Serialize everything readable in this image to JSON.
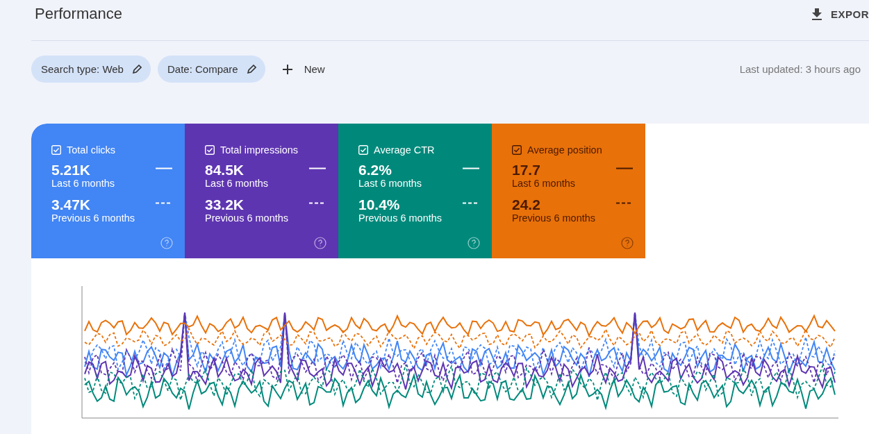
{
  "header": {
    "title": "Performance",
    "export_label": "EXPOR"
  },
  "filters": [
    {
      "label": "Search type: Web"
    },
    {
      "label": "Date: Compare"
    }
  ],
  "new_filter": {
    "label": "New"
  },
  "last_updated": "Last updated: 3 hours ago",
  "metrics": [
    {
      "label": "Total clicks",
      "checked": true,
      "color": "#4285f4",
      "current": "5.21K",
      "current_label": "Last 6 months",
      "previous": "3.47K",
      "previous_label": "Previous 6 months"
    },
    {
      "label": "Total impressions",
      "checked": true,
      "color": "#5e35b1",
      "current": "84.5K",
      "current_label": "Last 6 months",
      "previous": "33.2K",
      "previous_label": "Previous 6 months"
    },
    {
      "label": "Average CTR",
      "checked": true,
      "color": "#00897b",
      "current": "6.2%",
      "current_label": "Last 6 months",
      "previous": "10.4%",
      "previous_label": "Previous 6 months"
    },
    {
      "label": "Average position",
      "checked": true,
      "color": "#e8710a",
      "current": "17.7",
      "current_label": "Last 6 months",
      "previous": "24.2",
      "previous_label": "Previous 6 months"
    }
  ]
}
